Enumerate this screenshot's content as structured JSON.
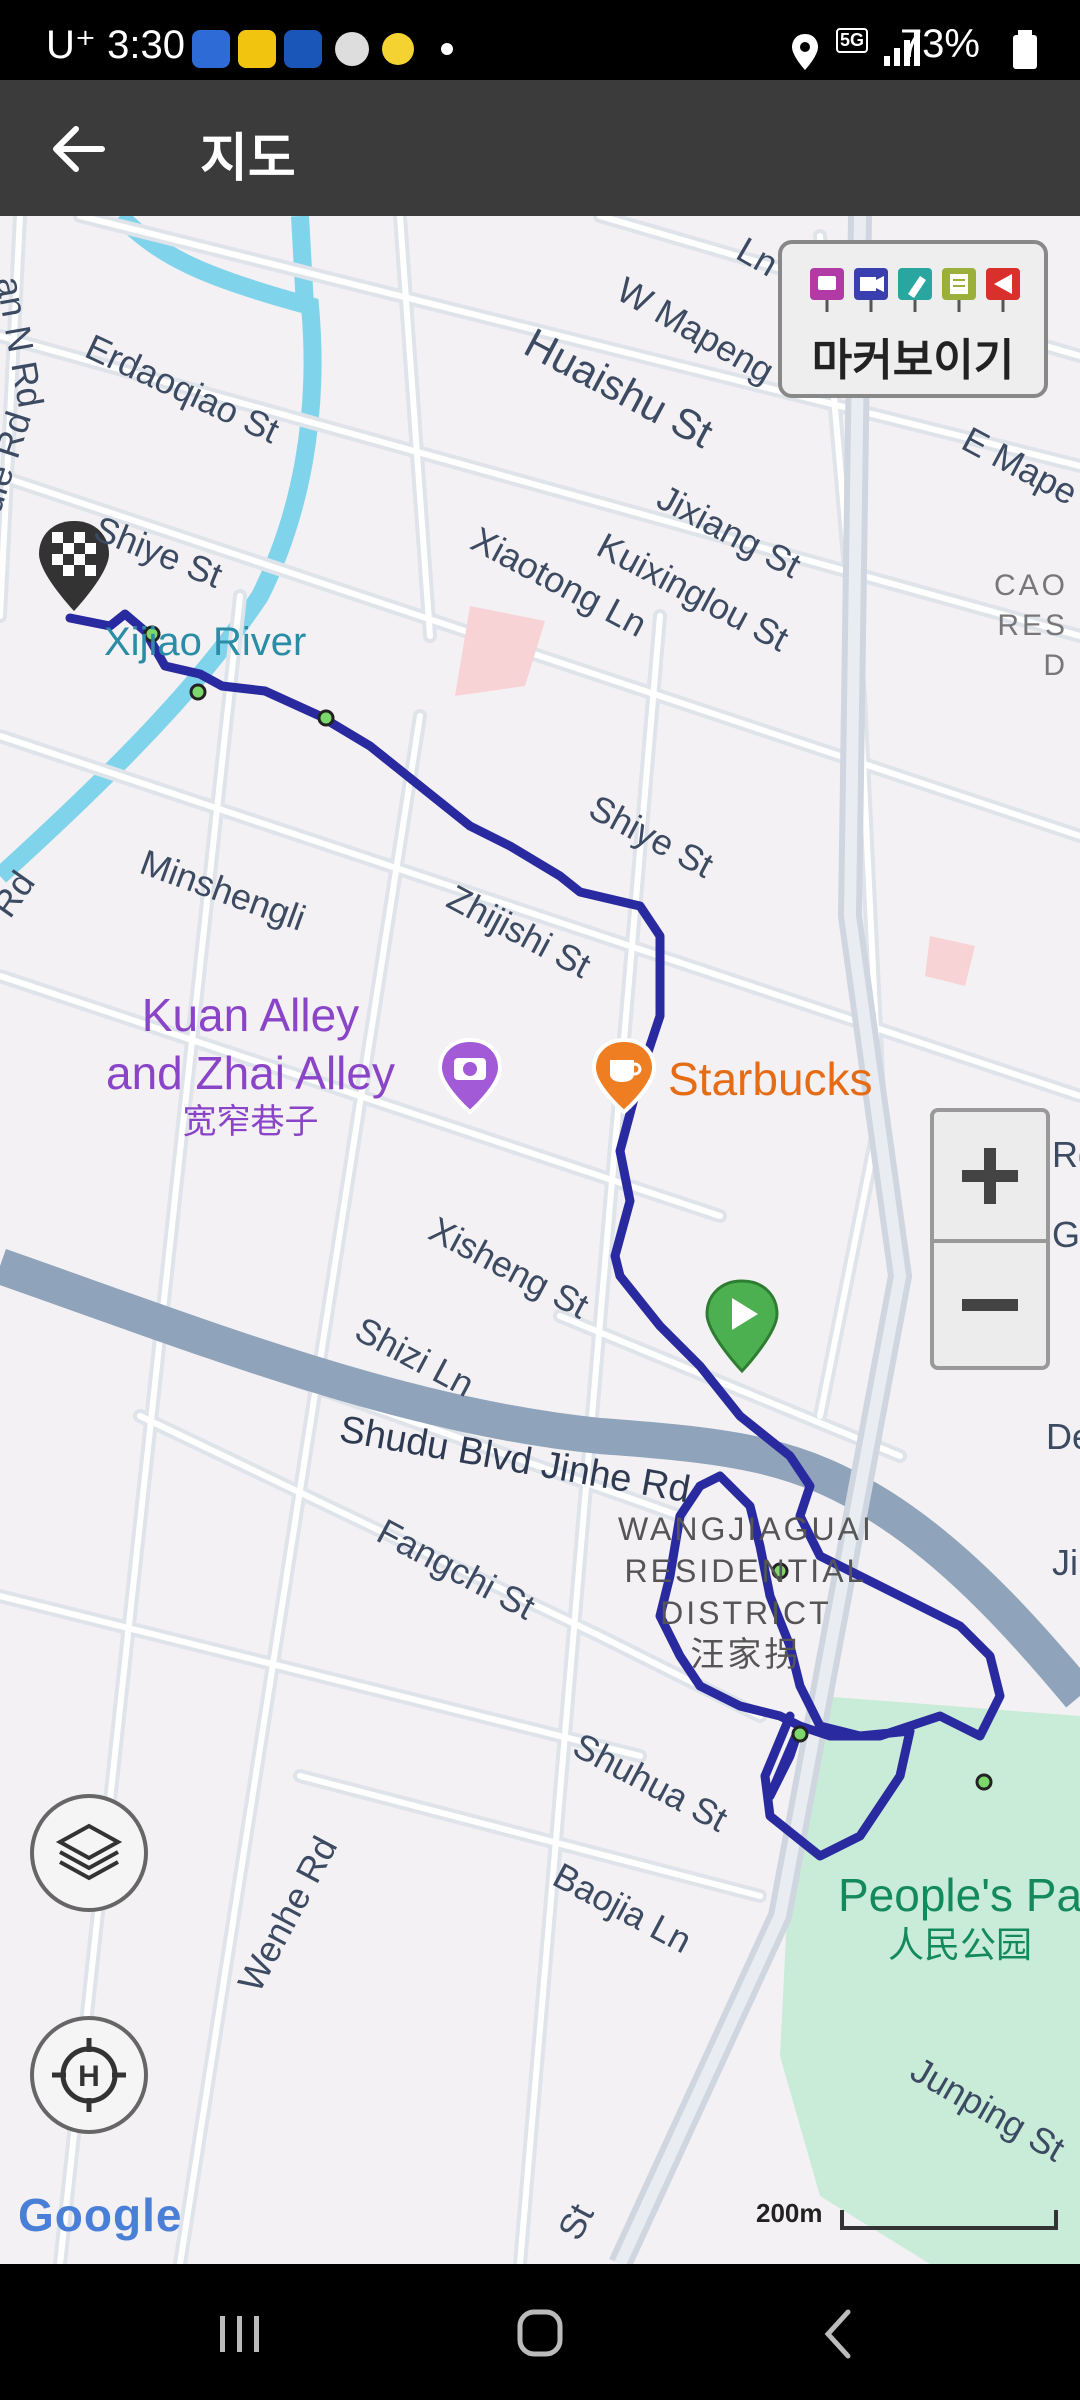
{
  "status_bar": {
    "time": "U⁺ 3:30",
    "battery": "73%",
    "network": "5G"
  },
  "app_bar": {
    "title": "지도",
    "back_icon": "arrow-left-icon"
  },
  "map": {
    "streets": [
      "an N Rd",
      "Erdaoqiao St",
      "Middle Rd",
      "Shiye St",
      "W Mapeng",
      "Ln",
      "Huaishu St",
      "E Mape",
      "Jixiang St",
      "Kuixinglou St",
      "Xiaotong Ln",
      "Shiye St",
      "Minshengli",
      "Zhijishi St",
      "Xisheng St",
      "Shizi Ln",
      "Shudu Blvd Jinhe Rd",
      "Fangchi St",
      "Shuhua St",
      "Baojia Ln",
      "Wenhe Rd",
      "Junping St",
      "Rd",
      "Rd",
      "G",
      "De",
      "Ji",
      "St"
    ],
    "water_label": "Xijiao River",
    "poi_kuan": {
      "line1": "Kuan Alley",
      "line2": "and Zhai Alley",
      "cn": "宽窄巷子"
    },
    "poi_starbucks": "Starbucks",
    "district": {
      "line1": "WANGJIAGUAI",
      "line2": "RESIDENTIAL",
      "line3": "DISTRICT",
      "cn": "汪家拐"
    },
    "park": {
      "name": "People's Pa",
      "cn": "人民公园"
    },
    "area_cao": {
      "line1": "CAO",
      "line2": "RES",
      "line3": "D"
    },
    "route_color": "#2a2aa0",
    "start_marker_color": "#4caf50",
    "finish_marker": "checkered-flag-icon",
    "waypoint_count": 6
  },
  "marker_panel": {
    "label": "마커보이기",
    "icons": [
      "camera-icon",
      "video-icon",
      "pen-icon",
      "note-icon",
      "flag-icon"
    ],
    "icon_colors": [
      "#b13aa6",
      "#3a3fb0",
      "#2aa6a0",
      "#9ab03a",
      "#d8312c"
    ]
  },
  "controls": {
    "zoom_in": "+",
    "zoom_out": "−",
    "layers_icon": "layers-icon",
    "home_icon": "home-locate-icon"
  },
  "footer": {
    "google": "Google",
    "scale": "200m"
  }
}
